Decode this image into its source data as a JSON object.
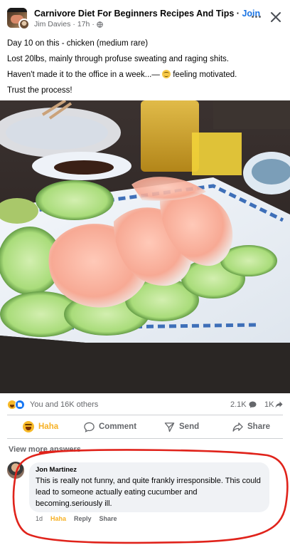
{
  "header": {
    "group_name": "Carnivore Diet For Beginners Recipes And Tips",
    "separator": " · ",
    "join_label": "Join",
    "author": "Jim Davies",
    "time": "17h",
    "close_label": "×"
  },
  "post": {
    "lines": [
      "Day 10 on this - chicken (medium rare)",
      "Lost 20lbs, mainly through profuse sweating and raging shits.",
      "Haven't made it to the office in a week...— ",
      "Trust the process!"
    ],
    "feeling": " feeling motivated."
  },
  "summary": {
    "reactors": "You and 16K others",
    "comments": "2.1K",
    "shares": "1K"
  },
  "actions": {
    "haha": "Haha",
    "comment": "Comment",
    "send": "Send",
    "share": "Share"
  },
  "comments": {
    "view_more": "View more answers",
    "items": [
      {
        "name": "Jon Martinez",
        "text": "This is really not funny, and quite frankly irresponsible. This could lead to someone actually eating cucumber and becoming.seriously ill.",
        "time": "1d",
        "reaction": "Haha",
        "reply": "Reply",
        "share": "Share"
      }
    ]
  },
  "colors": {
    "accent": "#1b74e4",
    "haha": "#f7b125",
    "annotation": "#e0231b",
    "muted": "#65676b"
  }
}
